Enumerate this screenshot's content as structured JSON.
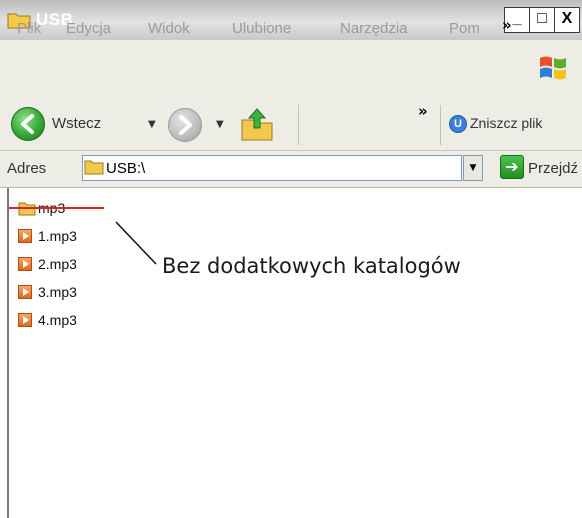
{
  "window": {
    "title": "USB",
    "controls": {
      "minimize": "_",
      "maximize": "□",
      "close": "X"
    }
  },
  "menubar": {
    "items": [
      "Plik",
      "Edycja",
      "Widok",
      "Ulubione",
      "Narzędzia",
      "Pom"
    ],
    "overflow": "»",
    "logo_icon": "windows-flag-icon"
  },
  "toolbar": {
    "back_label": "Wstecz",
    "forward_icon": "forward-arrow-icon",
    "up_icon": "folder-up-icon",
    "overflow": "»",
    "destroy_label": "Zniszcz plik"
  },
  "address": {
    "label": "Adres",
    "value": "USB:\\",
    "go_label": "Przejdź"
  },
  "files": [
    {
      "name": "mp3",
      "type": "folder",
      "crossed_out": true
    },
    {
      "name": "1.mp3",
      "type": "mp3"
    },
    {
      "name": "2.mp3",
      "type": "mp3"
    },
    {
      "name": "3.mp3",
      "type": "mp3"
    },
    {
      "name": "4.mp3",
      "type": "mp3"
    }
  ],
  "annotation": "Bez dodatkowych katalogów",
  "colors": {
    "strike_line": "#e02020",
    "go_green": "#2a9a2a",
    "folder_yellow": "#f2c94c"
  }
}
